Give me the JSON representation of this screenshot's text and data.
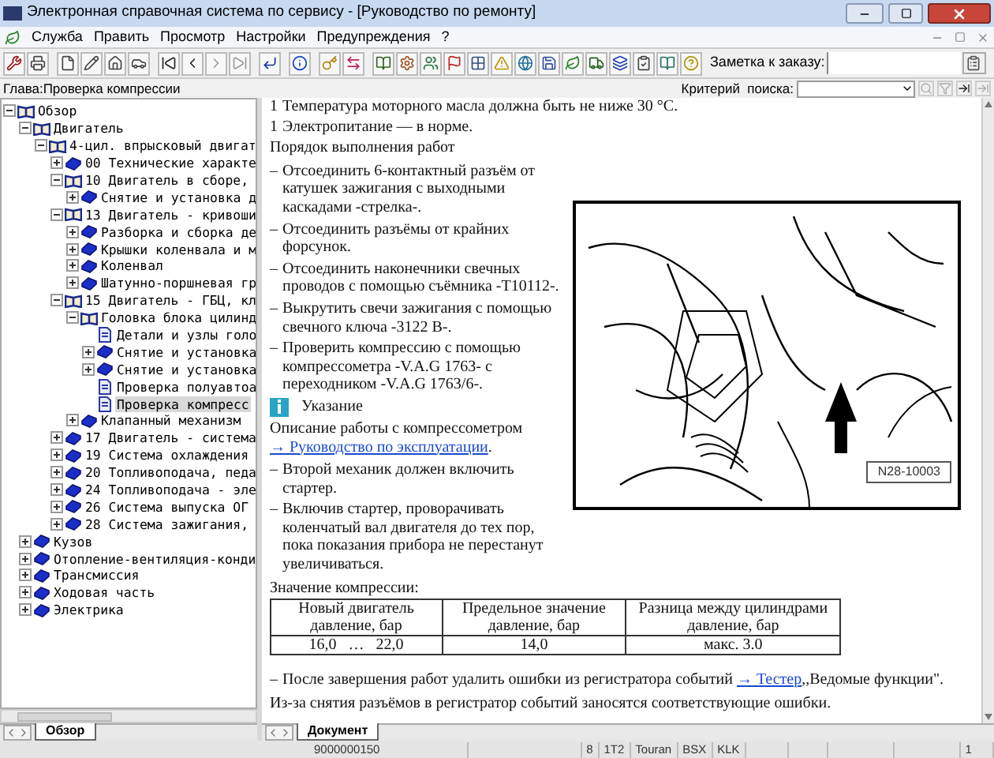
{
  "window": {
    "title": "Электронная справочная система по сервису - [Руководство по ремонту]"
  },
  "menu": [
    {
      "label": "Служба"
    },
    {
      "label": "Править"
    },
    {
      "label": "Просмотр"
    },
    {
      "label": "Настройки"
    },
    {
      "label": "Предупреждения"
    },
    {
      "label": "?"
    }
  ],
  "toolbar": {
    "note_label": "Заметка к заказу:"
  },
  "chapter_bar": {
    "chapter": "Глава:Проверка компрессии",
    "search_label": "Критерий  поиска:"
  },
  "tree": [
    {
      "label": "Обзор",
      "kind": "open-book",
      "expanded": true,
      "selected": false,
      "children": [
        {
          "label": "Двигатель",
          "kind": "open-book",
          "expanded": true,
          "selected": false,
          "children": [
            {
              "label": "4-цил. впрысковый двигат",
              "kind": "open-book",
              "expanded": true,
              "selected": false,
              "children": [
                {
                  "label": "00 Технические характе",
                  "kind": "book",
                  "expanded": false,
                  "selected": false
                },
                {
                  "label": "10 Двигатель в сборе,",
                  "kind": "open-book",
                  "expanded": true,
                  "selected": false,
                  "children": [
                    {
                      "label": "Снятие и установка д",
                      "kind": "book",
                      "expanded": false,
                      "selected": false
                    }
                  ]
                },
                {
                  "label": "13 Двигатель - кривоши",
                  "kind": "open-book",
                  "expanded": true,
                  "selected": false,
                  "children": [
                    {
                      "label": "Разборка и сборка де",
                      "kind": "book",
                      "expanded": false,
                      "selected": false
                    },
                    {
                      "label": "Крышки коленвала и м",
                      "kind": "book",
                      "expanded": false,
                      "selected": false
                    },
                    {
                      "label": "Коленвал",
                      "kind": "book",
                      "expanded": false,
                      "selected": false
                    },
                    {
                      "label": "Шатунно-поршневая гр",
                      "kind": "book",
                      "expanded": false,
                      "selected": false
                    }
                  ]
                },
                {
                  "label": "15 Двигатель - ГБЦ, кл",
                  "kind": "open-book",
                  "expanded": true,
                  "selected": false,
                  "children": [
                    {
                      "label": "Головка блока цилинд",
                      "kind": "open-book",
                      "expanded": true,
                      "selected": false,
                      "children": [
                        {
                          "label": "Детали и узлы голо",
                          "kind": "page",
                          "selected": false
                        },
                        {
                          "label": "Снятие и установка",
                          "kind": "book",
                          "expanded": false,
                          "selected": false
                        },
                        {
                          "label": "Снятие и установка",
                          "kind": "book",
                          "expanded": false,
                          "selected": false
                        },
                        {
                          "label": "Проверка полуавтоа",
                          "kind": "page",
                          "selected": false
                        },
                        {
                          "label": "Проверка компресс",
                          "kind": "page",
                          "selected": true
                        }
                      ]
                    },
                    {
                      "label": "Клапанный механизм",
                      "kind": "book",
                      "expanded": false,
                      "selected": false
                    }
                  ]
                },
                {
                  "label": "17 Двигатель - система",
                  "kind": "book",
                  "expanded": false,
                  "selected": false
                },
                {
                  "label": "19 Система охлаждения",
                  "kind": "book",
                  "expanded": false,
                  "selected": false
                },
                {
                  "label": "20 Топливоподача, педа",
                  "kind": "book",
                  "expanded": false,
                  "selected": false
                },
                {
                  "label": "24 Топливоподача - эле",
                  "kind": "book",
                  "expanded": false,
                  "selected": false
                },
                {
                  "label": "26 Система выпуска ОГ",
                  "kind": "book",
                  "expanded": false,
                  "selected": false
                },
                {
                  "label": "28 Система зажигания,",
                  "kind": "book",
                  "expanded": false,
                  "selected": false
                }
              ]
            }
          ]
        },
        {
          "label": "Кузов",
          "kind": "book",
          "expanded": false,
          "selected": false
        },
        {
          "label": "Отопление-вентиляция-конди",
          "kind": "book",
          "expanded": false,
          "selected": false
        },
        {
          "label": "Трансмиссия",
          "kind": "book",
          "expanded": false,
          "selected": false
        },
        {
          "label": "Ходовая часть",
          "kind": "book",
          "expanded": false,
          "selected": false
        },
        {
          "label": "Электрика",
          "kind": "book",
          "expanded": false,
          "selected": false
        }
      ]
    }
  ],
  "left_tabs": [
    {
      "label": "Обзор",
      "selected": true
    }
  ],
  "document": {
    "top": {
      "marker": "1",
      "text": "Температура моторного масла должна быть не ниже 30 °C."
    },
    "blocks": [
      {
        "kind": "item",
        "marker": "1",
        "text": "Электропитание — в норме."
      },
      {
        "kind": "para",
        "text": "Порядок выполнения работ"
      },
      {
        "kind": "item",
        "marker": "–",
        "text": "Отсоединить 6-контактный разъём от катушек зажигания с выходными каскадами -стрелка-."
      },
      {
        "kind": "item",
        "marker": "–",
        "text": "Отсоединить разъёмы от крайних форсунок."
      },
      {
        "kind": "item",
        "marker": "–",
        "text": "Отсоединить наконечники свечных проводов с помощью съёмника -T10112-."
      },
      {
        "kind": "item",
        "marker": "–",
        "text": "Выкрутить свечи зажигания с помощью свечного ключа -3122 B-."
      },
      {
        "kind": "item",
        "marker": "–",
        "text": "Проверить компрессию с помощью компрессометра -V.A.G 1763- с переходником -V.A.G 1763/6-."
      },
      {
        "kind": "note",
        "text": "Указание"
      },
      {
        "kind": "link",
        "text": "Описание работы с компрессометром",
        "link": "→ Руководство по эксплуатации",
        "after": "."
      },
      {
        "kind": "item",
        "marker": "–",
        "text": "Второй механик должен включить стартер."
      },
      {
        "kind": "item",
        "marker": "–",
        "text": "Включив стартер, проворачивать коленчатый вал двигателя до тех пор, пока показания прибора не перестанут увеличиваться."
      }
    ],
    "figure": {
      "label": "N28-10003"
    },
    "table_title": "Значение компрессии:",
    "table": {
      "columns": [
        "Новый двигатель давление, бар",
        "Предельное значение давление, бар",
        "Разница между цилиндрами давление, бар"
      ],
      "rows": [
        [
          "16,0   …   22,0",
          "14,0",
          "макс. 3.0"
        ]
      ]
    },
    "final": {
      "marker": "–",
      "text": "После завершения работ удалить ошибки из регистратора событий ",
      "link": "→ Тестер",
      "after": ",,Ведомые функции\"."
    },
    "closing": "Из-за снятия разъёмов в регистратор событий заносятся соответствующие ошибки."
  },
  "doc_tabs": [
    {
      "label": "Документ",
      "selected": true
    }
  ],
  "status_bar": {
    "order_number": "9000000150",
    "vehicle": [
      "8",
      "1T2",
      "Touran",
      "BSX",
      "KLK"
    ],
    "page": "1"
  }
}
